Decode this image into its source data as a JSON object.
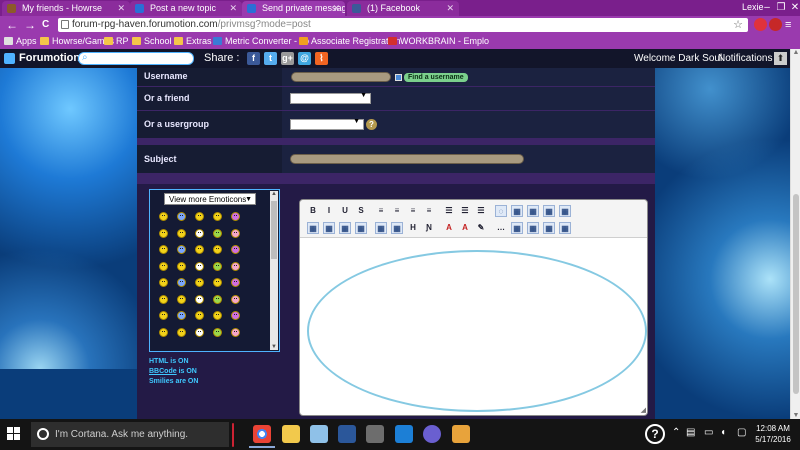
{
  "browser": {
    "tabs": [
      {
        "title": "My friends - Howrse",
        "color": "#8c5a2a"
      },
      {
        "title": "Post a new topic",
        "color": "#2a6fd6"
      },
      {
        "title": "Send private message",
        "color": "#2a6fd6"
      },
      {
        "title": "(1) Facebook",
        "color": "#3b5998"
      }
    ],
    "profile": "Lexie",
    "window_controls": [
      "–",
      "❐",
      "✕"
    ],
    "nav": {
      "back": "←",
      "forward": "→",
      "reload": "C"
    },
    "url_host": "forum-rpg-haven.forumotion.com",
    "url_path": "/privmsg?mode=post",
    "star": "☆",
    "bookmarks": [
      "Apps",
      "Howrse/Games",
      "RP",
      "School",
      "Extras",
      "Metric Converter - co",
      "Associate Registration",
      "WORKBRAIN - Emplo"
    ]
  },
  "forumotion": {
    "logo": "Forumotion",
    "share_label": "Share :",
    "share_icons": [
      {
        "name": "facebook",
        "glyph": "f",
        "color": "#3b5998"
      },
      {
        "name": "twitter",
        "glyph": "t",
        "color": "#55acee"
      },
      {
        "name": "google-plus",
        "glyph": "g+",
        "color": "#9a9a9a"
      },
      {
        "name": "email",
        "glyph": "@",
        "color": "#3fa7e0"
      },
      {
        "name": "rss",
        "glyph": "⌇",
        "color": "#f26522"
      }
    ],
    "welcome": "Welcome Dark Soul",
    "notifications": "Notifications",
    "home_glyph": "⬆"
  },
  "form": {
    "username_label": "Username",
    "find_username": "Find a username",
    "friend_label": "Or a friend",
    "usergroup_label": "Or a usergroup",
    "subject_label": "Subject",
    "help_glyph": "?"
  },
  "emoticons": {
    "select_label": "View more Emoticons",
    "html_status": "HTML is ON",
    "bbcode_link": "BBCode",
    "bbcode_status": " is ON",
    "smilies_status": "Smilies are ON"
  },
  "editor": {
    "toolbar_row1": [
      "B",
      "I",
      "U",
      "S",
      "≡",
      "≡",
      "≡",
      "≡",
      "☰",
      "☰",
      "☰",
      "◌",
      "▦",
      "▦",
      "▦",
      "▦"
    ],
    "toolbar_row2": [
      "▦",
      "▦",
      "▦",
      "▦",
      "▦",
      "▦",
      "H",
      "Ɲ",
      "A",
      "A",
      "✎",
      "…",
      "▦",
      "▦",
      "▦",
      "▦"
    ]
  },
  "taskbar": {
    "cortana_text": "I'm Cortana. Ask me anything.",
    "help": "?",
    "time": "12:08 AM",
    "date": "5/17/2016"
  }
}
